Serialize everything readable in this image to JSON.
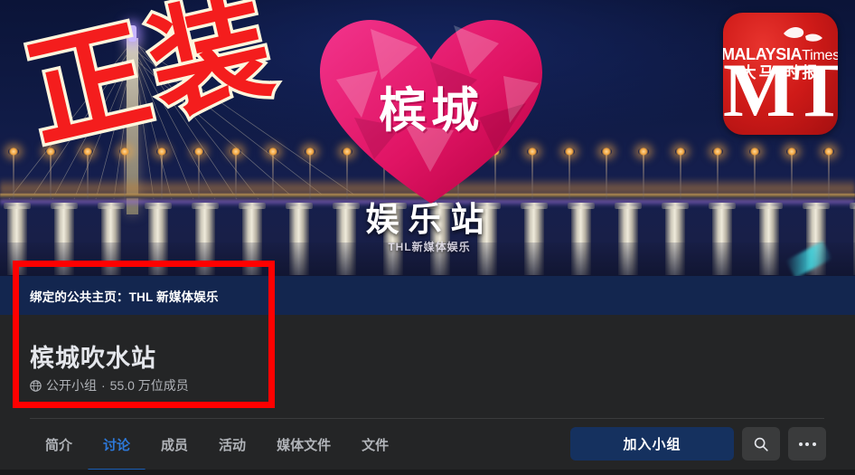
{
  "cover": {
    "stamp_text": "正装",
    "heart_text": "槟城",
    "sub_text": "娱乐站",
    "tiny_text": "THL新媒体娱乐",
    "logo": {
      "brand_main": "MALAYSIA",
      "brand_sub": "Times",
      "brand_cn": "大马 时报",
      "monogram": "MT"
    }
  },
  "linked_page": {
    "text": "绑定的公共主页：THL 新媒体娱乐"
  },
  "group": {
    "name": "槟城吹水站",
    "privacy": "公开小组",
    "separator": "·",
    "members": "55.0 万位成员",
    "meta_full": "公开小组 · 55.0 万位成员"
  },
  "tabs": [
    {
      "label": "简介",
      "active": false
    },
    {
      "label": "讨论",
      "active": true
    },
    {
      "label": "成员",
      "active": false
    },
    {
      "label": "活动",
      "active": false
    },
    {
      "label": "媒体文件",
      "active": false
    },
    {
      "label": "文件",
      "active": false
    }
  ],
  "actions": {
    "join_label": "加入小组",
    "search_icon": "search-icon",
    "more_icon": "ellipsis-icon"
  },
  "colors": {
    "page_bg": "#242526",
    "linked_bar": "#13264f",
    "join_button": "#15315f",
    "tab_active": "#2d78d8",
    "tab_underline": "#1b5fb8",
    "annotation_red": "#ff0000",
    "stamp_red": "#f41d1d",
    "stamp_outline": "#fdf6dd",
    "logo_red": "#cf1a18"
  }
}
